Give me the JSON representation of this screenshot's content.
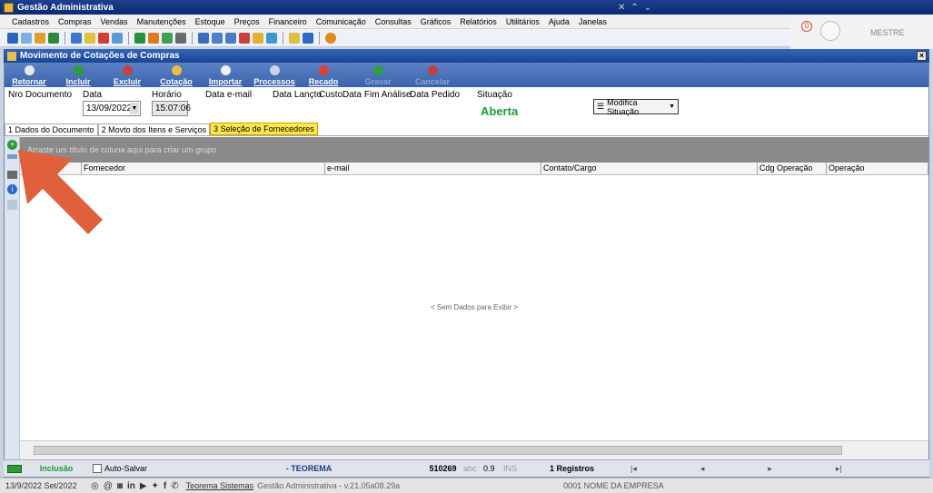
{
  "window": {
    "title": "Gestão Administrativa"
  },
  "menu": [
    "Cadastros",
    "Compras",
    "Vendas",
    "Manutenções",
    "Estoque",
    "Preços",
    "Financeiro",
    "Comunicação",
    "Consultas",
    "Gráficos",
    "Relatórios",
    "Utilitários",
    "Ajuda",
    "Janelas"
  ],
  "user": {
    "badge": "0",
    "name": "MESTRE"
  },
  "form": {
    "title": "Movimento de Cotações de Compras",
    "ribbon": [
      {
        "label": "Retornar",
        "icon": "return-icon",
        "enabled": true
      },
      {
        "label": "Incluir",
        "icon": "add-icon",
        "enabled": true
      },
      {
        "label": "Excluir",
        "icon": "delete-icon",
        "enabled": true
      },
      {
        "label": "Cotação",
        "icon": "quote-icon",
        "enabled": true
      },
      {
        "label": "Importar",
        "icon": "import-icon",
        "enabled": true
      },
      {
        "label": "Processos",
        "icon": "process-icon",
        "enabled": true
      },
      {
        "label": "Recado",
        "icon": "message-icon",
        "enabled": true
      },
      {
        "label": "Gravar",
        "icon": "check-icon",
        "enabled": false
      },
      {
        "label": "Cancelar",
        "icon": "cancel-icon",
        "enabled": false
      }
    ],
    "labels": {
      "nro": "Nro Documento",
      "data": "Data",
      "horario": "Horário",
      "email": "Data e-mail",
      "lancto": "Data Lançto",
      "custo": "Custo",
      "fim": "Data Fim Análise",
      "pedido": "Data Pedido",
      "situacao": "Situação"
    },
    "values": {
      "data": "13/09/2022",
      "horario": "15:07:06",
      "situacao": "Aberta"
    },
    "modify_button": "Modifica Situação",
    "tabs": [
      "1 Dados do Documento",
      "2 Movto dos Itens e Serviços",
      "3 Seleção de Fornecedores"
    ],
    "active_tab": 2,
    "group_hint": "Arraste um título de coluna aqui para criar um grupo",
    "columns": [
      "",
      "Fornecedor",
      "e-mail",
      "Contato/Cargo",
      "Cdg Operação",
      "Operação"
    ],
    "empty_text": "< Sem Dados para Exibir >"
  },
  "status": {
    "mode": "Inclusão",
    "autosave": "Auto-Salvar",
    "company": "- TEOREMA",
    "code": "510269",
    "abc": "abc",
    "num": "0.9",
    "ins": "INS",
    "records": "1 Registros"
  },
  "footer": {
    "date": "13/9/2022 Set/2022",
    "brand": "Teorema Sistemas",
    "app": "Gestão Administrativa - v.21.05a08.29a",
    "empresa": "0001 NOME DA EMPRESA"
  },
  "colors": {
    "accent": "#1a9c3a",
    "arrow": "#e0603c",
    "tab_active": "#ffe84a"
  }
}
